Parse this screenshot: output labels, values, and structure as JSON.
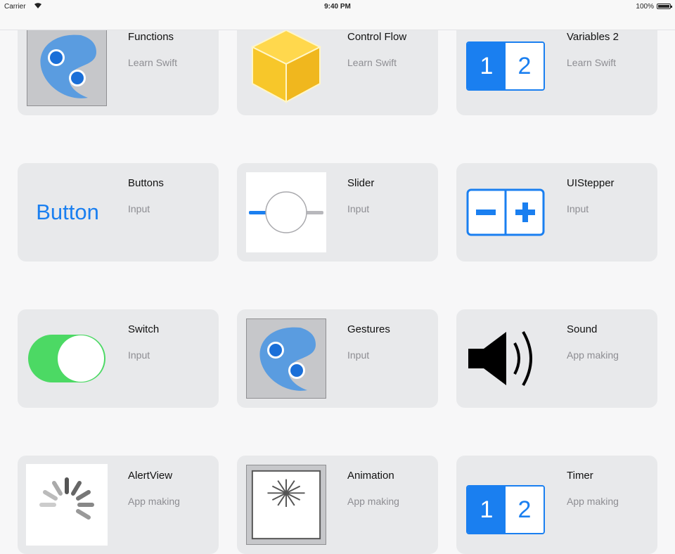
{
  "status_bar": {
    "carrier": "Carrier",
    "time": "9:40 PM",
    "battery": "100%"
  },
  "lessons": [
    {
      "title": "Functions",
      "subtitle": "Learn Swift",
      "icon": "yin-yang-icon"
    },
    {
      "title": "Control Flow",
      "subtitle": "Learn Swift",
      "icon": "cube-icon"
    },
    {
      "title": "Variables 2",
      "subtitle": "Learn Swift",
      "icon": "variables-12-icon"
    },
    {
      "title": "Buttons",
      "subtitle": "Input",
      "icon": "button-text-icon",
      "icon_text": "Button"
    },
    {
      "title": "Slider",
      "subtitle": "Input",
      "icon": "slider-icon"
    },
    {
      "title": "UIStepper",
      "subtitle": "Input",
      "icon": "stepper-icon"
    },
    {
      "title": "Switch",
      "subtitle": "Input",
      "icon": "switch-icon"
    },
    {
      "title": "Gestures",
      "subtitle": "Input",
      "icon": "yin-yang-icon"
    },
    {
      "title": "Sound",
      "subtitle": "App making",
      "icon": "speaker-icon"
    },
    {
      "title": "AlertView",
      "subtitle": "App making",
      "icon": "spinner-icon"
    },
    {
      "title": "Animation",
      "subtitle": "App making",
      "icon": "burst-icon"
    },
    {
      "title": "Timer",
      "subtitle": "App making",
      "icon": "variables-12-icon"
    }
  ],
  "icon_labels": {
    "one": "1",
    "two": "2"
  },
  "colors": {
    "accent_blue": "#1a7ff0",
    "switch_green": "#4cd964",
    "cube_yellow": "#f7c72a",
    "card_bg": "#e8e9eb"
  }
}
